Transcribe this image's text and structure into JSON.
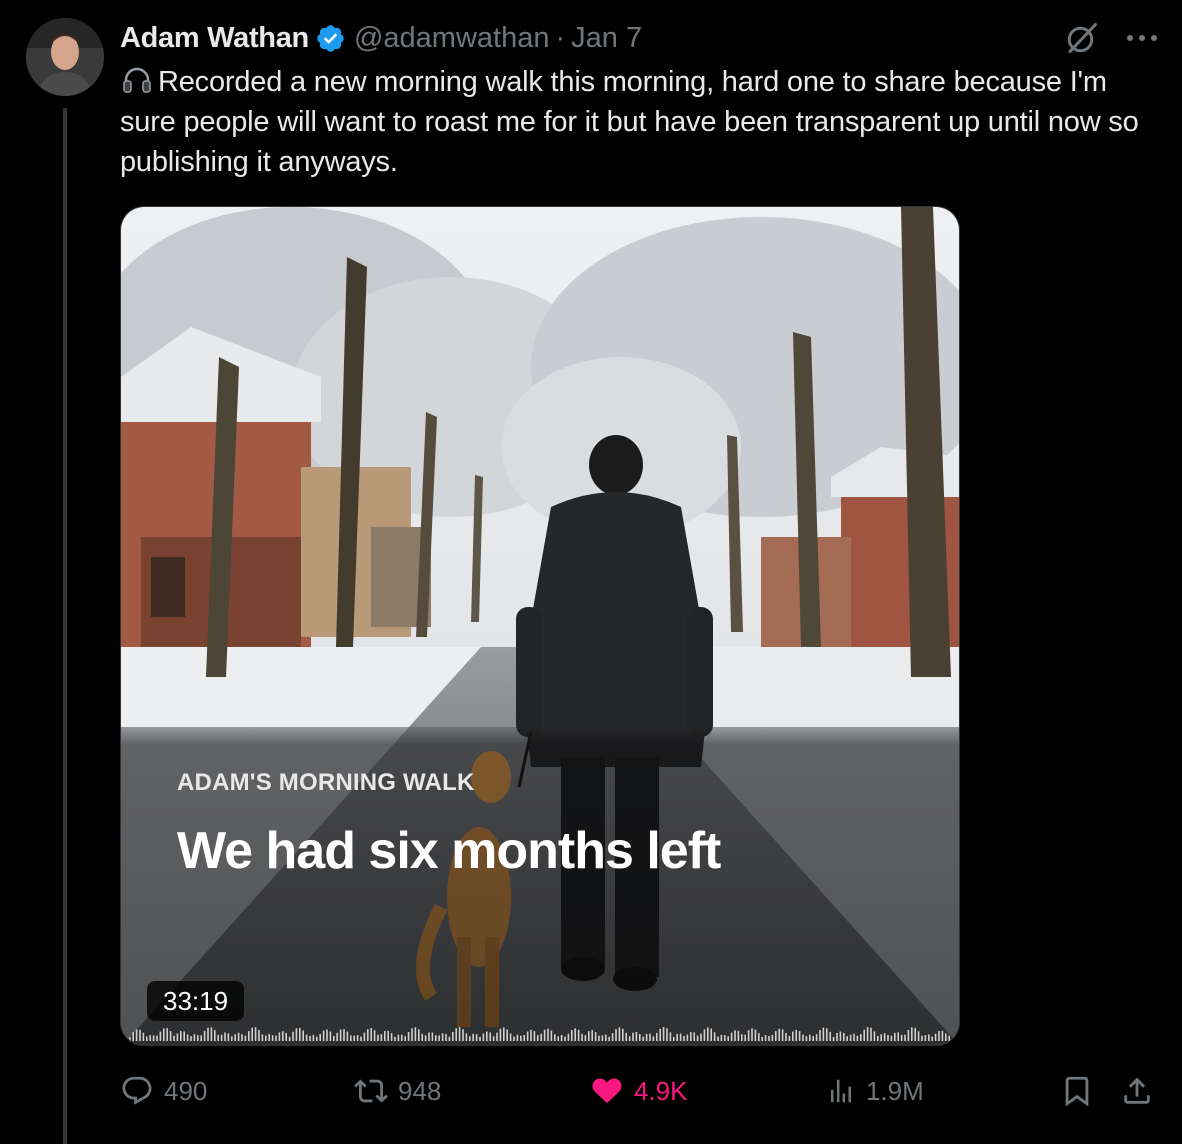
{
  "author": {
    "name": "Adam Wathan",
    "handle": "@adamwathan",
    "separator": "·",
    "date": "Jan 7",
    "verified": true
  },
  "tweet": {
    "text": "Recorded a new morning walk this morning, hard one to share because I'm sure people will want to roast me for it but have been transparent up until now so publishing it anyways.",
    "leading_icon": "headphones-icon"
  },
  "media": {
    "series_label": "ADAM'S MORNING WALK",
    "episode_title": "We had six months left",
    "duration": "33:19"
  },
  "actions": {
    "replies": "490",
    "reposts": "948",
    "likes": "4.9K",
    "views": "1.9M"
  },
  "header_icons": [
    "grok-slash-icon",
    "more-icon"
  ],
  "colors": {
    "background": "#000000",
    "text": "#e7e9ea",
    "muted": "#71767b",
    "verified": "#1d9bf0",
    "like": "#f91880"
  }
}
